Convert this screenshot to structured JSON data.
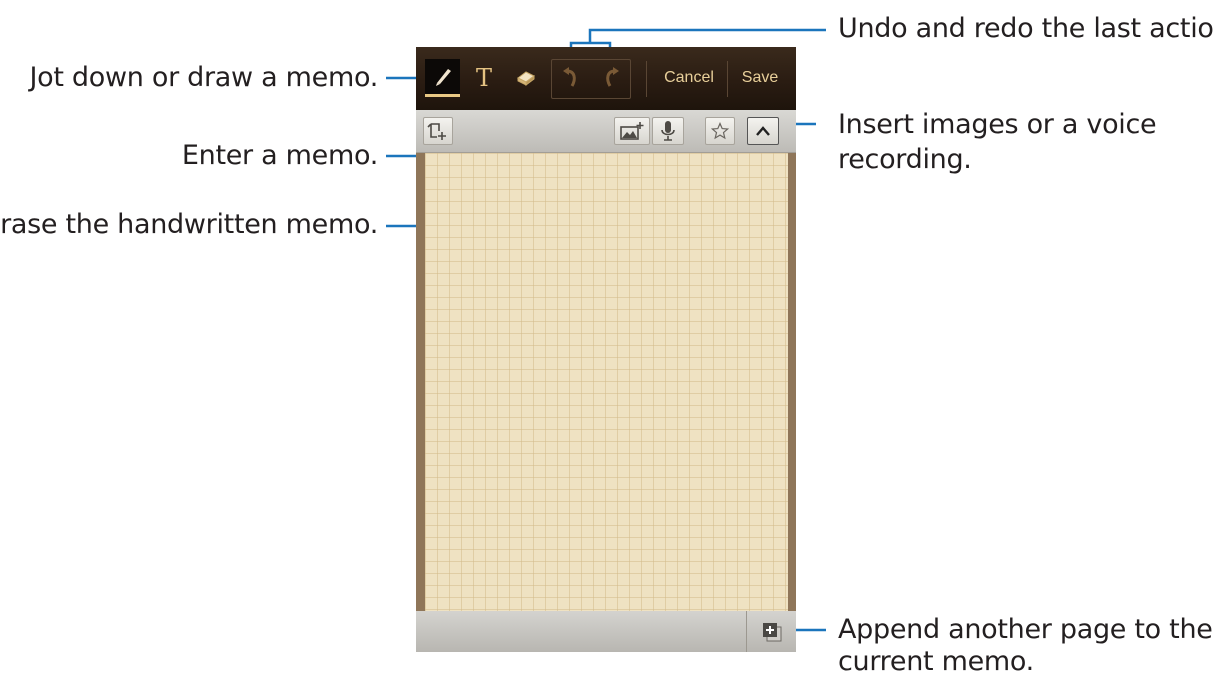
{
  "callouts": {
    "undo_redo": "Undo and redo the last action.",
    "pen": "Jot down or draw a memo.",
    "text": "Enter a memo.",
    "eraser": "Erase the handwritten memo.",
    "insert_line1": "Insert images or a voice",
    "insert_line2": "recording.",
    "append_line1": "Append another page to the",
    "append_line2": "current memo."
  },
  "toolbar": {
    "cancel_label": "Cancel",
    "save_label": "Save",
    "text_tool_glyph": "T",
    "icons": [
      "pen-icon",
      "text-icon",
      "eraser-icon",
      "undo-icon",
      "redo-icon"
    ]
  },
  "subtoolbar": {
    "icons": [
      "page-settings-icon",
      "insert-image-icon",
      "microphone-icon",
      "star-icon",
      "chevron-up-icon"
    ]
  },
  "bottombar": {
    "icons": [
      "add-page-icon"
    ]
  },
  "colors": {
    "callout_line": "#1b75bc",
    "toolbar_bg": "#2a1c12",
    "paper": "#efe2c2",
    "accent": "#e4c282"
  }
}
